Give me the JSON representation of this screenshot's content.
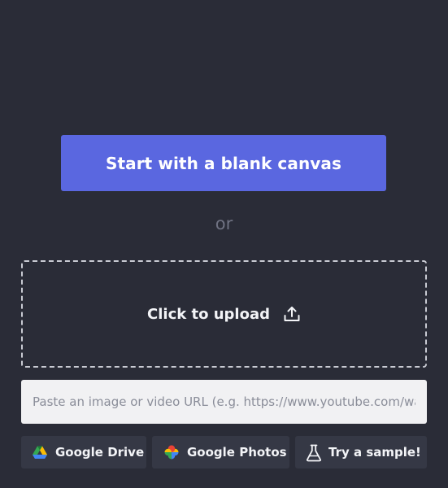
{
  "main": {
    "blank_canvas_label": "Start with a blank canvas",
    "or_label": "or",
    "upload_label": "Click to upload",
    "url_placeholder": "Paste an image or video URL (e.g. https://www.youtube.com/watch?v=...)",
    "url_value": ""
  },
  "sources": {
    "drive_label": "Google Drive",
    "photos_label": "Google Photos",
    "sample_label": "Try a sample!"
  },
  "icons": {
    "upload": "upload-icon",
    "drive": "google-drive-icon",
    "photos": "google-photos-icon",
    "sample": "flask-icon"
  },
  "colors": {
    "background": "#2a2c37",
    "primary": "#5a67e0",
    "secondary_button": "#353845",
    "input_background": "#f1f1f3"
  }
}
